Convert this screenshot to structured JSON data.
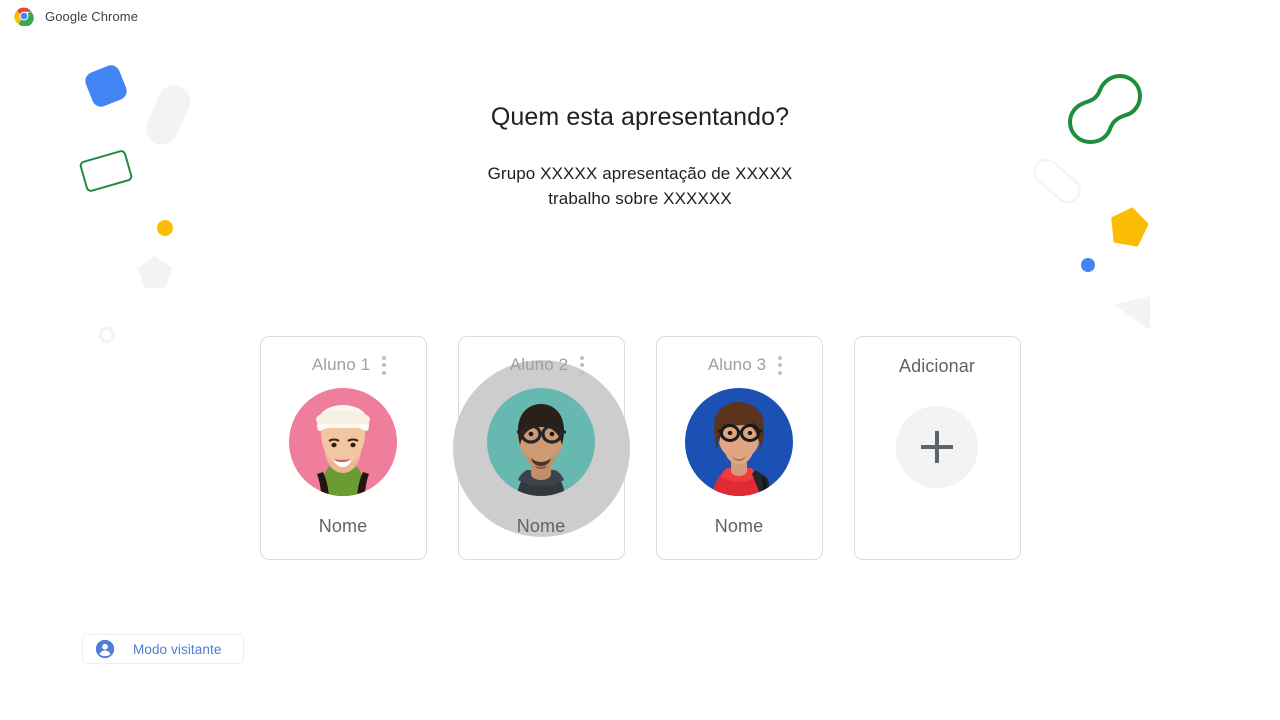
{
  "window": {
    "app_title": "Google Chrome",
    "logo_icon": "chrome-logo-icon"
  },
  "main": {
    "title": "Quem esta apresentando?",
    "subtitle_line1": "Grupo XXXXX  apresentação de XXXXX",
    "subtitle_line2": "trabalho sobre XXXXXX"
  },
  "profiles": [
    {
      "title": "Aluno 1",
      "name": "Nome",
      "menu_icon": "more-vert-icon",
      "avatar_icon": "avatar-photo-pink",
      "avatar_bg": "#ef7e9c",
      "hovered": false
    },
    {
      "title": "Aluno 2",
      "name": "Nome",
      "menu_icon": "more-vert-icon",
      "avatar_icon": "avatar-photo-teal",
      "avatar_bg": "#66b8b0",
      "hovered": true
    },
    {
      "title": "Aluno 3",
      "name": "Nome",
      "menu_icon": "more-vert-icon",
      "avatar_icon": "avatar-photo-blue",
      "avatar_bg": "#1b50b5",
      "hovered": false
    }
  ],
  "add_profile": {
    "title": "Adicionar",
    "icon": "plus-icon",
    "circle_color": "#f1f3f4"
  },
  "guest_mode": {
    "label": "Modo visitante",
    "icon": "person-circle-icon",
    "label_color": "#4e7cd6"
  },
  "decorations": [
    {
      "name": "blue-rounded-square",
      "color": "#4285f4"
    },
    {
      "name": "gray-capsule",
      "color": "#f1f3f4"
    },
    {
      "name": "green-outlined-rectangle",
      "color": "#1e8e3e"
    },
    {
      "name": "yellow-dot",
      "color": "#fbbc04"
    },
    {
      "name": "gray-pentagon",
      "color": "#f1f3f4"
    },
    {
      "name": "gray-ring",
      "color": "#f1f3f4"
    },
    {
      "name": "green-peanut-outline",
      "color": "#1e8e3e"
    },
    {
      "name": "gray-capsule-outline",
      "color": "#f1f3f4"
    },
    {
      "name": "yellow-pentagon",
      "color": "#fbbc04"
    },
    {
      "name": "blue-dot",
      "color": "#4285f4"
    },
    {
      "name": "gray-triangle",
      "color": "#f1f3f4"
    }
  ],
  "theme": {
    "background": "#ffffff",
    "title_color": "#202124",
    "muted_text": "#9aa0a6",
    "body_text": "#5f6368",
    "card_border": "#dadce0",
    "hover_glow": "#cdcdcd"
  }
}
